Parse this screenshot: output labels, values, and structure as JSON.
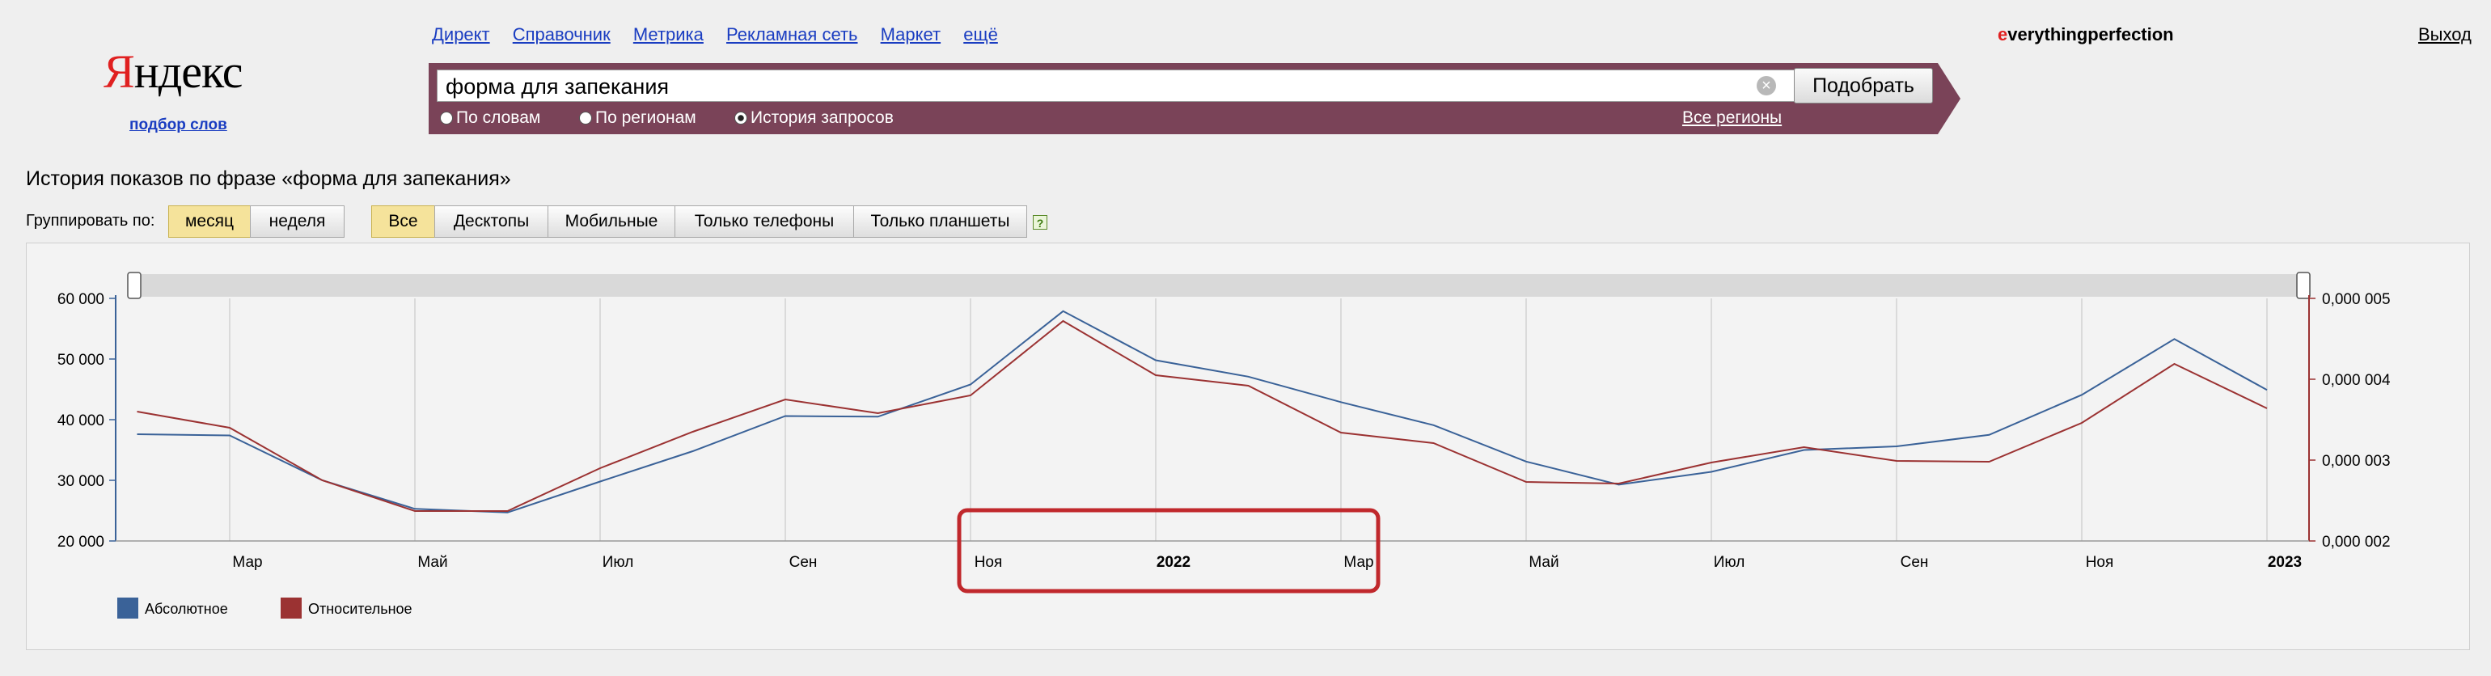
{
  "header": {
    "logo_first": "Я",
    "logo_rest": "ндекс",
    "logo_sub": "подбор слов",
    "services": [
      "Директ",
      "Справочник",
      "Метрика",
      "Рекламная сеть",
      "Маркет",
      "ещё"
    ],
    "user_first": "e",
    "user_rest": "verythingperfection",
    "logout": "Выход"
  },
  "search": {
    "value": "форма для запекания",
    "clear": "×",
    "submit": "Подобрать",
    "modes": [
      "По словам",
      "По регионам",
      "История запросов"
    ],
    "selected_mode": "История запросов",
    "regions": "Все регионы"
  },
  "page": {
    "title": "История показов по фразе «форма для запекания»",
    "group_label": "Группировать по:",
    "group_buttons": [
      "месяц",
      "неделя"
    ],
    "group_selected": "месяц",
    "device_buttons": [
      "Все",
      "Десктопы",
      "Мобильные",
      "Только телефоны",
      "Только планшеты"
    ],
    "device_selected": "Все",
    "help": "?"
  },
  "colors": {
    "absolute": "#3a6298",
    "relative": "#9b3232",
    "highlight": "#c0282c",
    "searchbar": "#7a4358",
    "active_button": "#f5e39b"
  },
  "chart_data": {
    "type": "line",
    "x_tick_labels": [
      "Мар",
      "Май",
      "Июл",
      "Сен",
      "Ноя",
      "2022",
      "Мар",
      "Май",
      "Июл",
      "Сен",
      "Ноя",
      "2023"
    ],
    "x_tick_months": [
      "2021-03",
      "2021-05",
      "2021-07",
      "2021-09",
      "2021-11",
      "2022-01",
      "2022-03",
      "2022-05",
      "2022-07",
      "2022-09",
      "2022-11",
      "2023-01"
    ],
    "x": [
      "2021-02",
      "2021-03",
      "2021-04",
      "2021-05",
      "2021-06",
      "2021-07",
      "2021-08",
      "2021-09",
      "2021-10",
      "2021-11",
      "2021-12",
      "2022-01",
      "2022-02",
      "2022-03",
      "2022-04",
      "2022-05",
      "2022-06",
      "2022-07",
      "2022-08",
      "2022-09",
      "2022-10",
      "2022-11",
      "2022-12",
      "2023-01"
    ],
    "series": [
      {
        "name": "Абсолютное",
        "axis": "left",
        "values": [
          37600,
          37400,
          30000,
          25300,
          24700,
          29800,
          34800,
          40600,
          40500,
          45800,
          57900,
          49800,
          47100,
          42900,
          39100,
          33100,
          29300,
          31400,
          35000,
          35600,
          37500,
          44100,
          53300,
          44900
        ]
      },
      {
        "name": "Относительное",
        "axis": "right",
        "values": [
          0.0036,
          0.0034,
          0.00275,
          0.00237,
          0.00237,
          0.0029,
          0.00335,
          0.00375,
          0.00358,
          0.0038,
          0.00472,
          0.00405,
          0.00392,
          0.00334,
          0.00321,
          0.00273,
          0.00271,
          0.00297,
          0.00316,
          0.00299,
          0.00298,
          0.00346,
          0.00419,
          0.00364
        ]
      }
    ],
    "y_left": {
      "ticks": [
        "20 000",
        "30 000",
        "40 000",
        "50 000",
        "60 000"
      ],
      "range": [
        20000,
        60000
      ]
    },
    "y_right": {
      "ticks": [
        "0,000 002",
        "0,000 003",
        "0,000 004",
        "0,000 005"
      ],
      "range": [
        0.002,
        0.005
      ]
    },
    "legend": [
      "Абсолютное",
      "Относительное"
    ],
    "legend_position": "bottom-left",
    "grid": "vertical",
    "highlight_box_months": [
      "2021-11",
      "2022-03"
    ]
  }
}
